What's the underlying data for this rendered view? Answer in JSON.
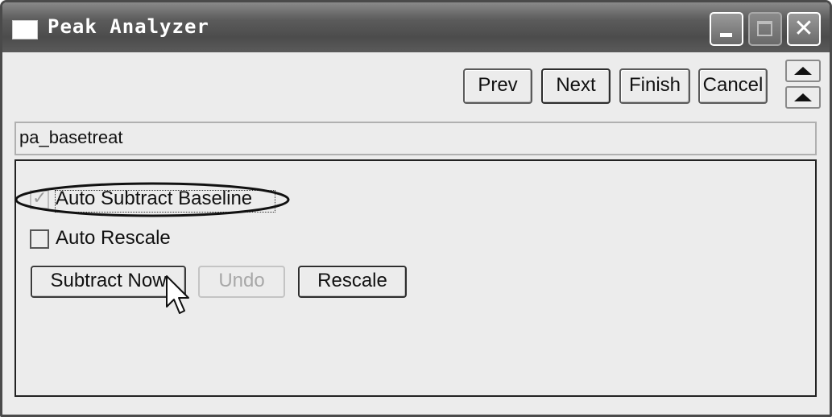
{
  "window": {
    "title": "Peak Analyzer",
    "close_glyph": "✕",
    "icons": {
      "app": "window-app-icon",
      "minimize": "minimize-icon",
      "maximize": "maximize-icon",
      "close": "close-icon"
    }
  },
  "nav": {
    "prev_label": "Prev",
    "next_label": "Next",
    "finish_label": "Finish",
    "cancel_label": "Cancel",
    "spin_icons": [
      "arrow-up-icon",
      "arrow-up-icon"
    ]
  },
  "page_name": "pa_basetreat",
  "options": {
    "auto_subtract_baseline": {
      "label": "Auto Subtract Baseline",
      "checked": true,
      "disabled": true
    },
    "auto_rescale": {
      "label": "Auto Rescale",
      "checked": false
    }
  },
  "actions": {
    "subtract_now_label": "Subtract Now",
    "undo_label": "Undo",
    "undo_disabled": true,
    "rescale_label": "Rescale"
  },
  "annotation": {
    "shape": "ellipse",
    "target": "auto-subtract-baseline-checkbox",
    "color": "#111111"
  },
  "cursor": {
    "type": "arrow-pointer-icon"
  }
}
